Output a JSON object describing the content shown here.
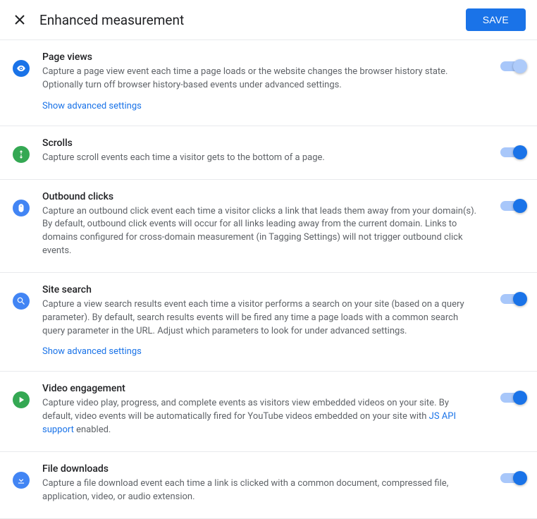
{
  "header": {
    "title": "Enhanced measurement",
    "save_label": "SAVE"
  },
  "advanced_settings_label": "Show advanced settings",
  "items": [
    {
      "title": "Page views",
      "desc": "Capture a page view event each time a page loads or the website changes the browser history state. Optionally turn off browser history-based events under advanced settings.",
      "show_advanced": true,
      "toggle_locked": true,
      "icon": "eye",
      "icon_bg": "blue"
    },
    {
      "title": "Scrolls",
      "desc": "Capture scroll events each time a visitor gets to the bottom of a page.",
      "show_advanced": false,
      "toggle_locked": false,
      "icon": "scroll",
      "icon_bg": "green"
    },
    {
      "title": "Outbound clicks",
      "desc": "Capture an outbound click event each time a visitor clicks a link that leads them away from your domain(s). By default, outbound click events will occur for all links leading away from the current domain. Links to domains configured for cross-domain measurement (in Tagging Settings) will not trigger outbound click events.",
      "show_advanced": false,
      "toggle_locked": false,
      "icon": "mouse",
      "icon_bg": "lightblue"
    },
    {
      "title": "Site search",
      "desc": "Capture a view search results event each time a visitor performs a search on your site (based on a query parameter). By default, search results events will be fired any time a page loads with a common search query parameter in the URL. Adjust which parameters to look for under advanced settings.",
      "show_advanced": true,
      "toggle_locked": false,
      "icon": "search",
      "icon_bg": "lightblue"
    },
    {
      "title": "Video engagement",
      "desc_pre": "Capture video play, progress, and complete events as visitors view embedded videos on your site. By default, video events will be automatically fired for YouTube videos embedded on your site with ",
      "desc_link": "JS API support",
      "desc_post": " enabled.",
      "show_advanced": false,
      "toggle_locked": false,
      "icon": "play",
      "icon_bg": "green"
    },
    {
      "title": "File downloads",
      "desc": "Capture a file download event each time a link is clicked with a common document, compressed file, application, video, or audio extension.",
      "show_advanced": false,
      "toggle_locked": false,
      "icon": "download",
      "icon_bg": "lightblue"
    }
  ]
}
